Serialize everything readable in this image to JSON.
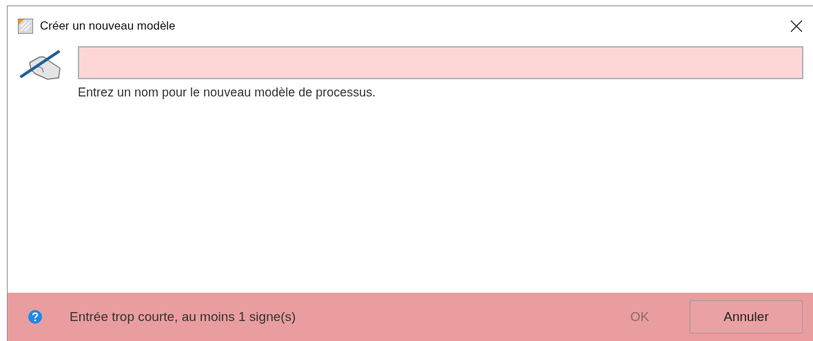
{
  "window": {
    "title": "Créer un nouveau modèle"
  },
  "name_field": {
    "invalid": true
  },
  "hint": "Entrez un nom pour le nouveau modèle de processus.",
  "footer": {
    "message": "Entrée trop courte, au moins 1 signe(s)",
    "error": true
  },
  "buttons": [
    {
      "label": "OK",
      "disabled": true
    },
    {
      "label": "Annuler",
      "disabled": false
    }
  ]
}
